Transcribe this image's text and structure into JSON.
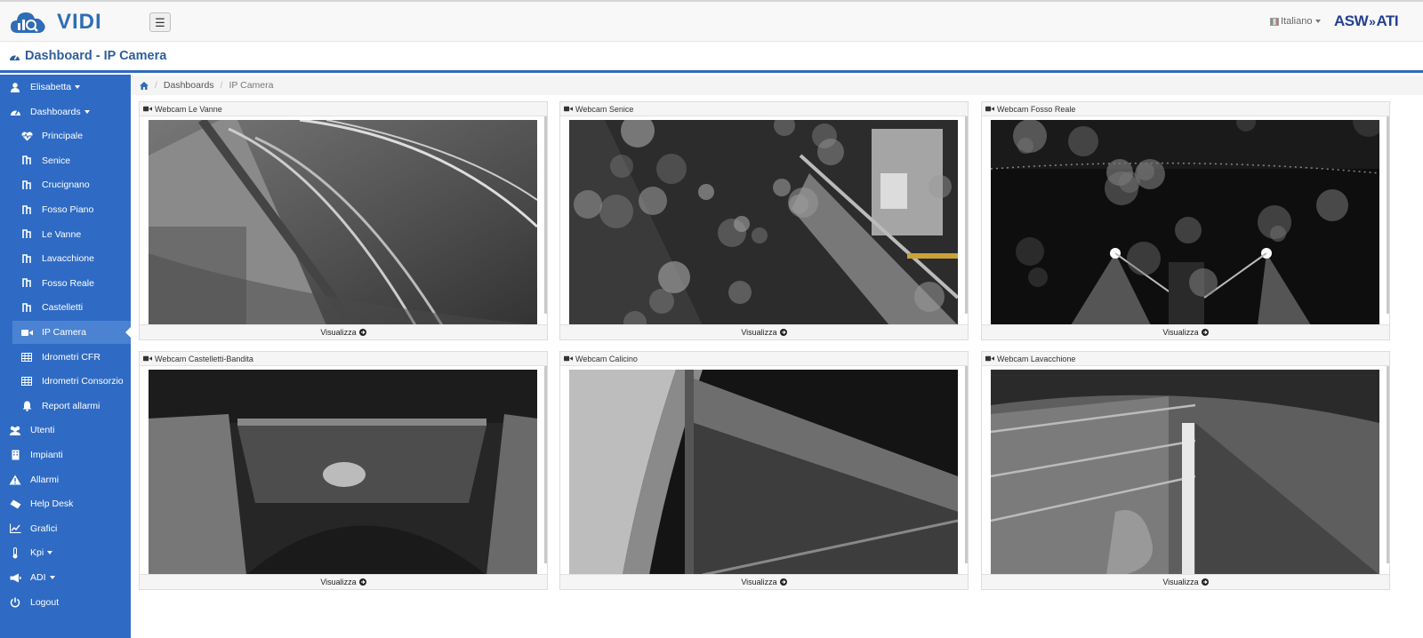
{
  "brand": {
    "name": "VIDI",
    "color": "#2f6db5"
  },
  "topbar": {
    "menu_icon": "☰",
    "language": "Italiano",
    "partner_logo": {
      "left": "ASW",
      "right": "ATI"
    }
  },
  "page": {
    "title": "Dashboard - IP Camera"
  },
  "sidebar": {
    "items": [
      {
        "label": "Elisabetta",
        "icon": "user-icon",
        "dropdown": true
      },
      {
        "label": "Dashboards",
        "icon": "dashboard-icon",
        "dropdown": true
      },
      {
        "label": "Principale",
        "icon": "heartbeat-icon"
      },
      {
        "label": "Senice",
        "icon": "flow-icon"
      },
      {
        "label": "Crucignano",
        "icon": "flow-icon"
      },
      {
        "label": "Fosso Piano",
        "icon": "flow-icon"
      },
      {
        "label": "Le Vanne",
        "icon": "flow-icon"
      },
      {
        "label": "Lavacchione",
        "icon": "flow-icon"
      },
      {
        "label": "Fosso Reale",
        "icon": "flow-icon"
      },
      {
        "label": "Castelletti",
        "icon": "flow-icon"
      },
      {
        "label": "IP Camera",
        "icon": "video-camera-icon",
        "active": true
      },
      {
        "label": "Idrometri CFR",
        "icon": "table-icon"
      },
      {
        "label": "Idrometri Consorzio",
        "icon": "table-icon"
      },
      {
        "label": "Report allarmi",
        "icon": "bell-icon"
      },
      {
        "label": "Utenti",
        "icon": "users-icon"
      },
      {
        "label": "Impianti",
        "icon": "building-icon"
      },
      {
        "label": "Allarmi",
        "icon": "warning-icon"
      },
      {
        "label": "Help Desk",
        "icon": "ticket-icon"
      },
      {
        "label": "Grafici",
        "icon": "line-chart-icon"
      },
      {
        "label": "Kpi",
        "icon": "thermometer-icon",
        "dropdown": true
      },
      {
        "label": "ADI",
        "icon": "megaphone-icon",
        "dropdown": true
      },
      {
        "label": "Logout",
        "icon": "power-icon"
      }
    ]
  },
  "breadcrumb": {
    "home_icon": "home-icon",
    "items": [
      "Dashboards",
      "IP Camera"
    ]
  },
  "cameras": [
    {
      "title": "Webcam Le Vanne",
      "action": "Visualizza"
    },
    {
      "title": "Webcam Senice",
      "action": "Visualizza"
    },
    {
      "title": "Webcam Fosso Reale",
      "action": "Visualizza"
    },
    {
      "title": "Webcam Castelletti-Bandita",
      "action": "Visualizza"
    },
    {
      "title": "Webcam Calicino",
      "action": "Visualizza"
    },
    {
      "title": "Webcam Lavacchione",
      "action": "Visualizza"
    }
  ],
  "colors": {
    "sidebar": "#2f6bc4",
    "sidebar_active": "#4b82d2",
    "accent_line": "#2e69c2"
  }
}
